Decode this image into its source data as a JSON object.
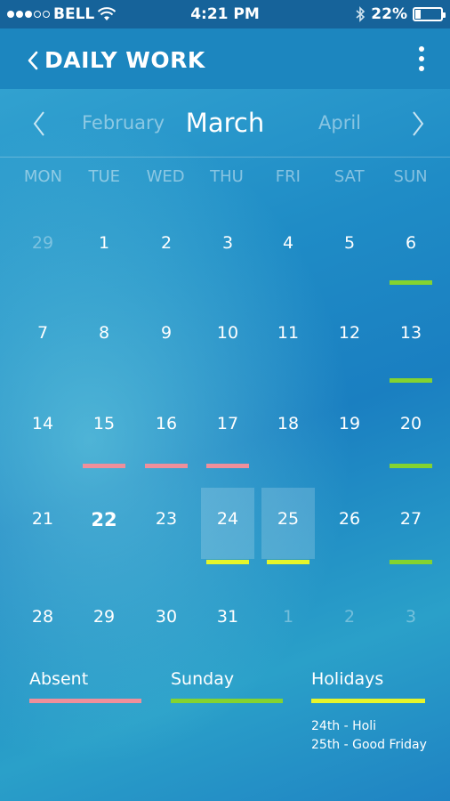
{
  "status": {
    "carrier": "BELL",
    "time": "4:21 PM",
    "battery": "22%",
    "battery_level": 0.22,
    "signal_bars_filled": 3,
    "signal_bars_total": 5
  },
  "header": {
    "title": "DAILY WORK",
    "back_icon": "chevron-left-icon",
    "menu_icon": "more-vertical-icon"
  },
  "month_nav": {
    "prev": "February",
    "current": "March",
    "next": "April"
  },
  "weekdays": [
    "MON",
    "TUE",
    "WED",
    "THU",
    "FRI",
    "SAT",
    "SUN"
  ],
  "weeks": [
    [
      {
        "d": "29",
        "muted": true
      },
      {
        "d": "1"
      },
      {
        "d": "2"
      },
      {
        "d": "3"
      },
      {
        "d": "4"
      },
      {
        "d": "5"
      },
      {
        "d": "6",
        "mark": "sunday"
      }
    ],
    [
      {
        "d": "7"
      },
      {
        "d": "8"
      },
      {
        "d": "9"
      },
      {
        "d": "10"
      },
      {
        "d": "11"
      },
      {
        "d": "12"
      },
      {
        "d": "13",
        "mark": "sunday"
      }
    ],
    [
      {
        "d": "14"
      },
      {
        "d": "15",
        "mark": "absent"
      },
      {
        "d": "16",
        "mark": "absent"
      },
      {
        "d": "17",
        "mark": "absent"
      },
      {
        "d": "18"
      },
      {
        "d": "19"
      },
      {
        "d": "20",
        "mark": "sunday"
      }
    ],
    [
      {
        "d": "21"
      },
      {
        "d": "22",
        "today": true
      },
      {
        "d": "23"
      },
      {
        "d": "24",
        "mark": "holiday",
        "selected": true
      },
      {
        "d": "25",
        "mark": "holiday",
        "selected": true
      },
      {
        "d": "26"
      },
      {
        "d": "27",
        "mark": "sunday"
      }
    ],
    [
      {
        "d": "28"
      },
      {
        "d": "29"
      },
      {
        "d": "30"
      },
      {
        "d": "31"
      },
      {
        "d": "1",
        "muted": true
      },
      {
        "d": "2",
        "muted": true
      },
      {
        "d": "3",
        "muted": true
      }
    ]
  ],
  "legend": {
    "absent": "Absent",
    "sunday": "Sunday",
    "holidays": "Holidays",
    "holiday_list": [
      "24th - Holi",
      "25th - Good Friday"
    ]
  },
  "colors": {
    "absent": "#ef8f9b",
    "sunday": "#84d330",
    "holiday": "#e6f52b"
  }
}
